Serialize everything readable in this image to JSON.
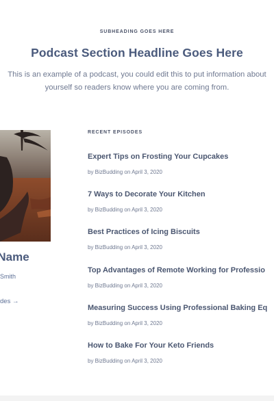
{
  "section": {
    "subheading": "SUBHEADING GOES HERE",
    "headline": "Podcast Section Headline Goes Here",
    "intro": "This is an example of a podcast, you could edit this to put information about yourself so readers know where you are coming from."
  },
  "host": {
    "name": "t Name",
    "subtitle": "Smith",
    "episodes_link": "des →"
  },
  "recent": {
    "label": "RECENT EPISODES",
    "episodes": [
      {
        "title": "Expert Tips on Frosting Your Cupcakes",
        "author": "BizBudding",
        "date": "April 3, 2020"
      },
      {
        "title": "7 Ways to Decorate Your Kitchen",
        "author": "BizBudding",
        "date": "April 3, 2020"
      },
      {
        "title": "Best Practices of Icing Biscuits",
        "author": "BizBudding",
        "date": "April 3, 2020"
      },
      {
        "title": "Top Advantages of Remote Working for Professio",
        "author": "BizBudding",
        "date": "April 3, 2020"
      },
      {
        "title": "Measuring Success Using Professional Baking Eq",
        "author": "BizBudding",
        "date": "April 3, 2020"
      },
      {
        "title": "How to Bake For Your Keto Friends",
        "author": "BizBudding",
        "date": "April 3, 2020"
      }
    ]
  }
}
